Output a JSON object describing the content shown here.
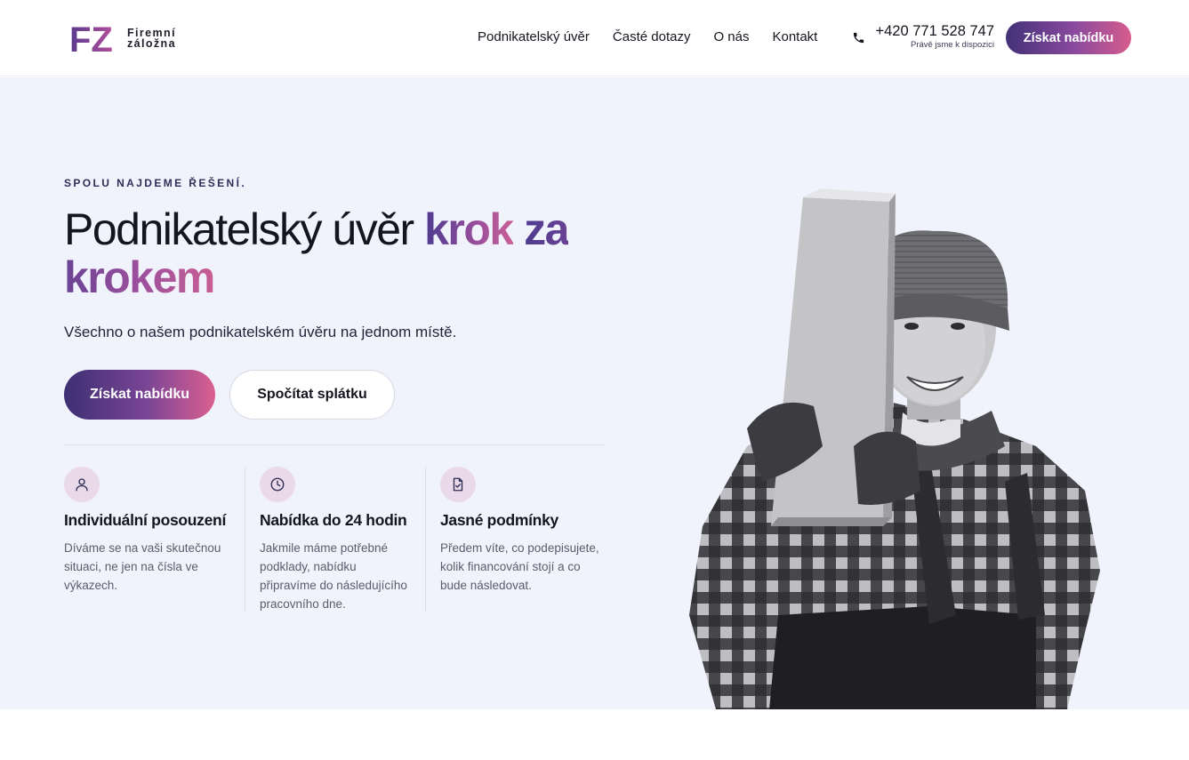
{
  "brand": {
    "mark": "FZ",
    "name_line1": "Firemní",
    "name_line2": "záložna"
  },
  "nav": [
    {
      "label": "Podnikatelský úvěr"
    },
    {
      "label": "Časté dotazy"
    },
    {
      "label": "O nás"
    },
    {
      "label": "Kontakt"
    }
  ],
  "contact": {
    "phone": "+420 771 528 747",
    "availability": "Právě jsme k dispozici"
  },
  "header_cta": "Získat nabídku",
  "hero": {
    "eyebrow": "SPOLU NAJDEME ŘEŠENÍ.",
    "title_dark": "Podnikatelský úvěr",
    "title_highlight_1": "krok",
    "title_highlight_2": "za krokem",
    "lead": "Všechno o našem podnikatelském úvěru na jednom místě.",
    "primary_cta": "Získat nabídku",
    "secondary_cta": "Spočítat splátku"
  },
  "features": [
    {
      "icon": "user-icon",
      "title": "Individuální posouzení",
      "description": "Díváme se na vaši skutečnou situaci, ne jen na čísla ve výkazech."
    },
    {
      "icon": "clock-icon",
      "title": "Nabídka do 24 hodin",
      "description": "Jakmile máme potřebné podklady, nabídku připravíme do následujícího pracovního dne."
    },
    {
      "icon": "file-check-icon",
      "title": "Jasné podmínky",
      "description": "Předem víte, co podepisujete, kolik financování stojí a co bude následovat."
    }
  ],
  "colors": {
    "accent_start": "#3d2f72",
    "accent_end": "#dc5f91",
    "hero_bg": "#f1f3fc",
    "icon_bg": "#ead9ea"
  }
}
